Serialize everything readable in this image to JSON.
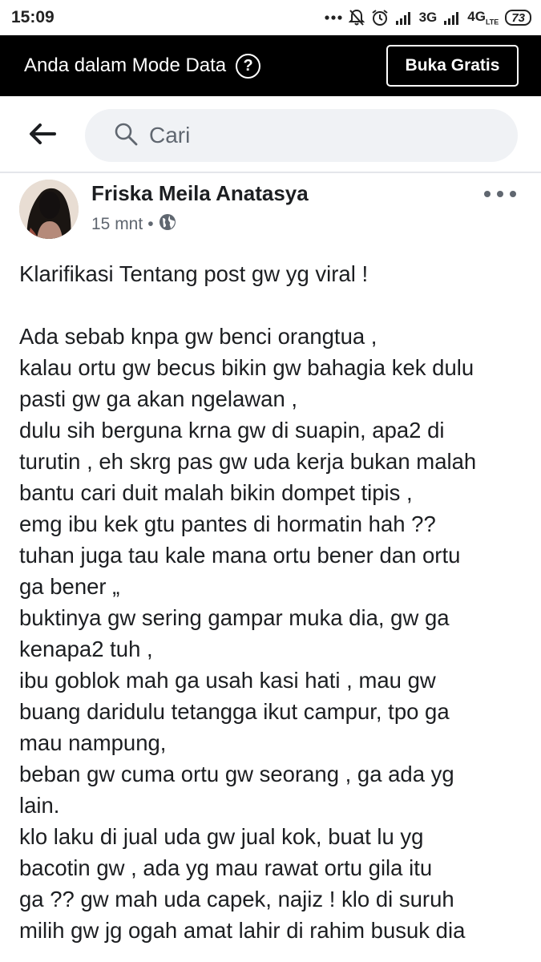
{
  "status_bar": {
    "time": "15:09",
    "network_3g": "3G",
    "network_4g": "4G",
    "network_4g_suffix": "LTE",
    "battery": "73",
    "icons": [
      "more-dots-icon",
      "bell-off-icon",
      "alarm-icon",
      "signal-icon",
      "signal-icon",
      "battery-icon"
    ]
  },
  "banner": {
    "text": "Anda dalam Mode Data",
    "help_symbol": "?",
    "button_label": "Buka Gratis"
  },
  "search": {
    "placeholder": "Cari"
  },
  "post": {
    "author": "Friska Meila Anatasya",
    "time": "15 mnt",
    "separator": "•",
    "privacy_icon": "globe-icon",
    "lines": [
      "Klarifikasi Tentang post gw yg viral !",
      "",
      "Ada sebab knpa gw benci orangtua ,",
      "kalau ortu gw becus bikin gw bahagia kek dulu",
      "pasti gw ga akan ngelawan ,",
      "dulu sih berguna krna gw di suapin, apa2 di",
      "turutin , eh skrg pas gw uda kerja bukan malah",
      "bantu cari duit malah bikin dompet tipis ,",
      "emg ibu kek gtu pantes di hormatin hah ??",
      "tuhan juga tau kale mana ortu bener dan ortu",
      "ga bener „",
      "buktinya gw sering gampar muka dia, gw ga",
      "kenapa2 tuh ,",
      "ibu goblok mah ga usah kasi hati , mau gw",
      "buang daridulu tetangga ikut campur, tpo ga",
      "mau nampung,",
      "beban gw cuma ortu gw seorang , ga ada yg",
      "lain.",
      "klo laku di jual uda gw jual kok, buat lu yg",
      "bacotin gw , ada yg mau rawat ortu gila itu",
      "ga ?? gw mah uda capek, najiz ! klo di suruh",
      "milih gw jg ogah amat lahir di rahim busuk dia"
    ]
  },
  "colors": {
    "banner_bg": "#000000",
    "search_bg": "#f0f2f5",
    "meta_text": "#606770"
  }
}
